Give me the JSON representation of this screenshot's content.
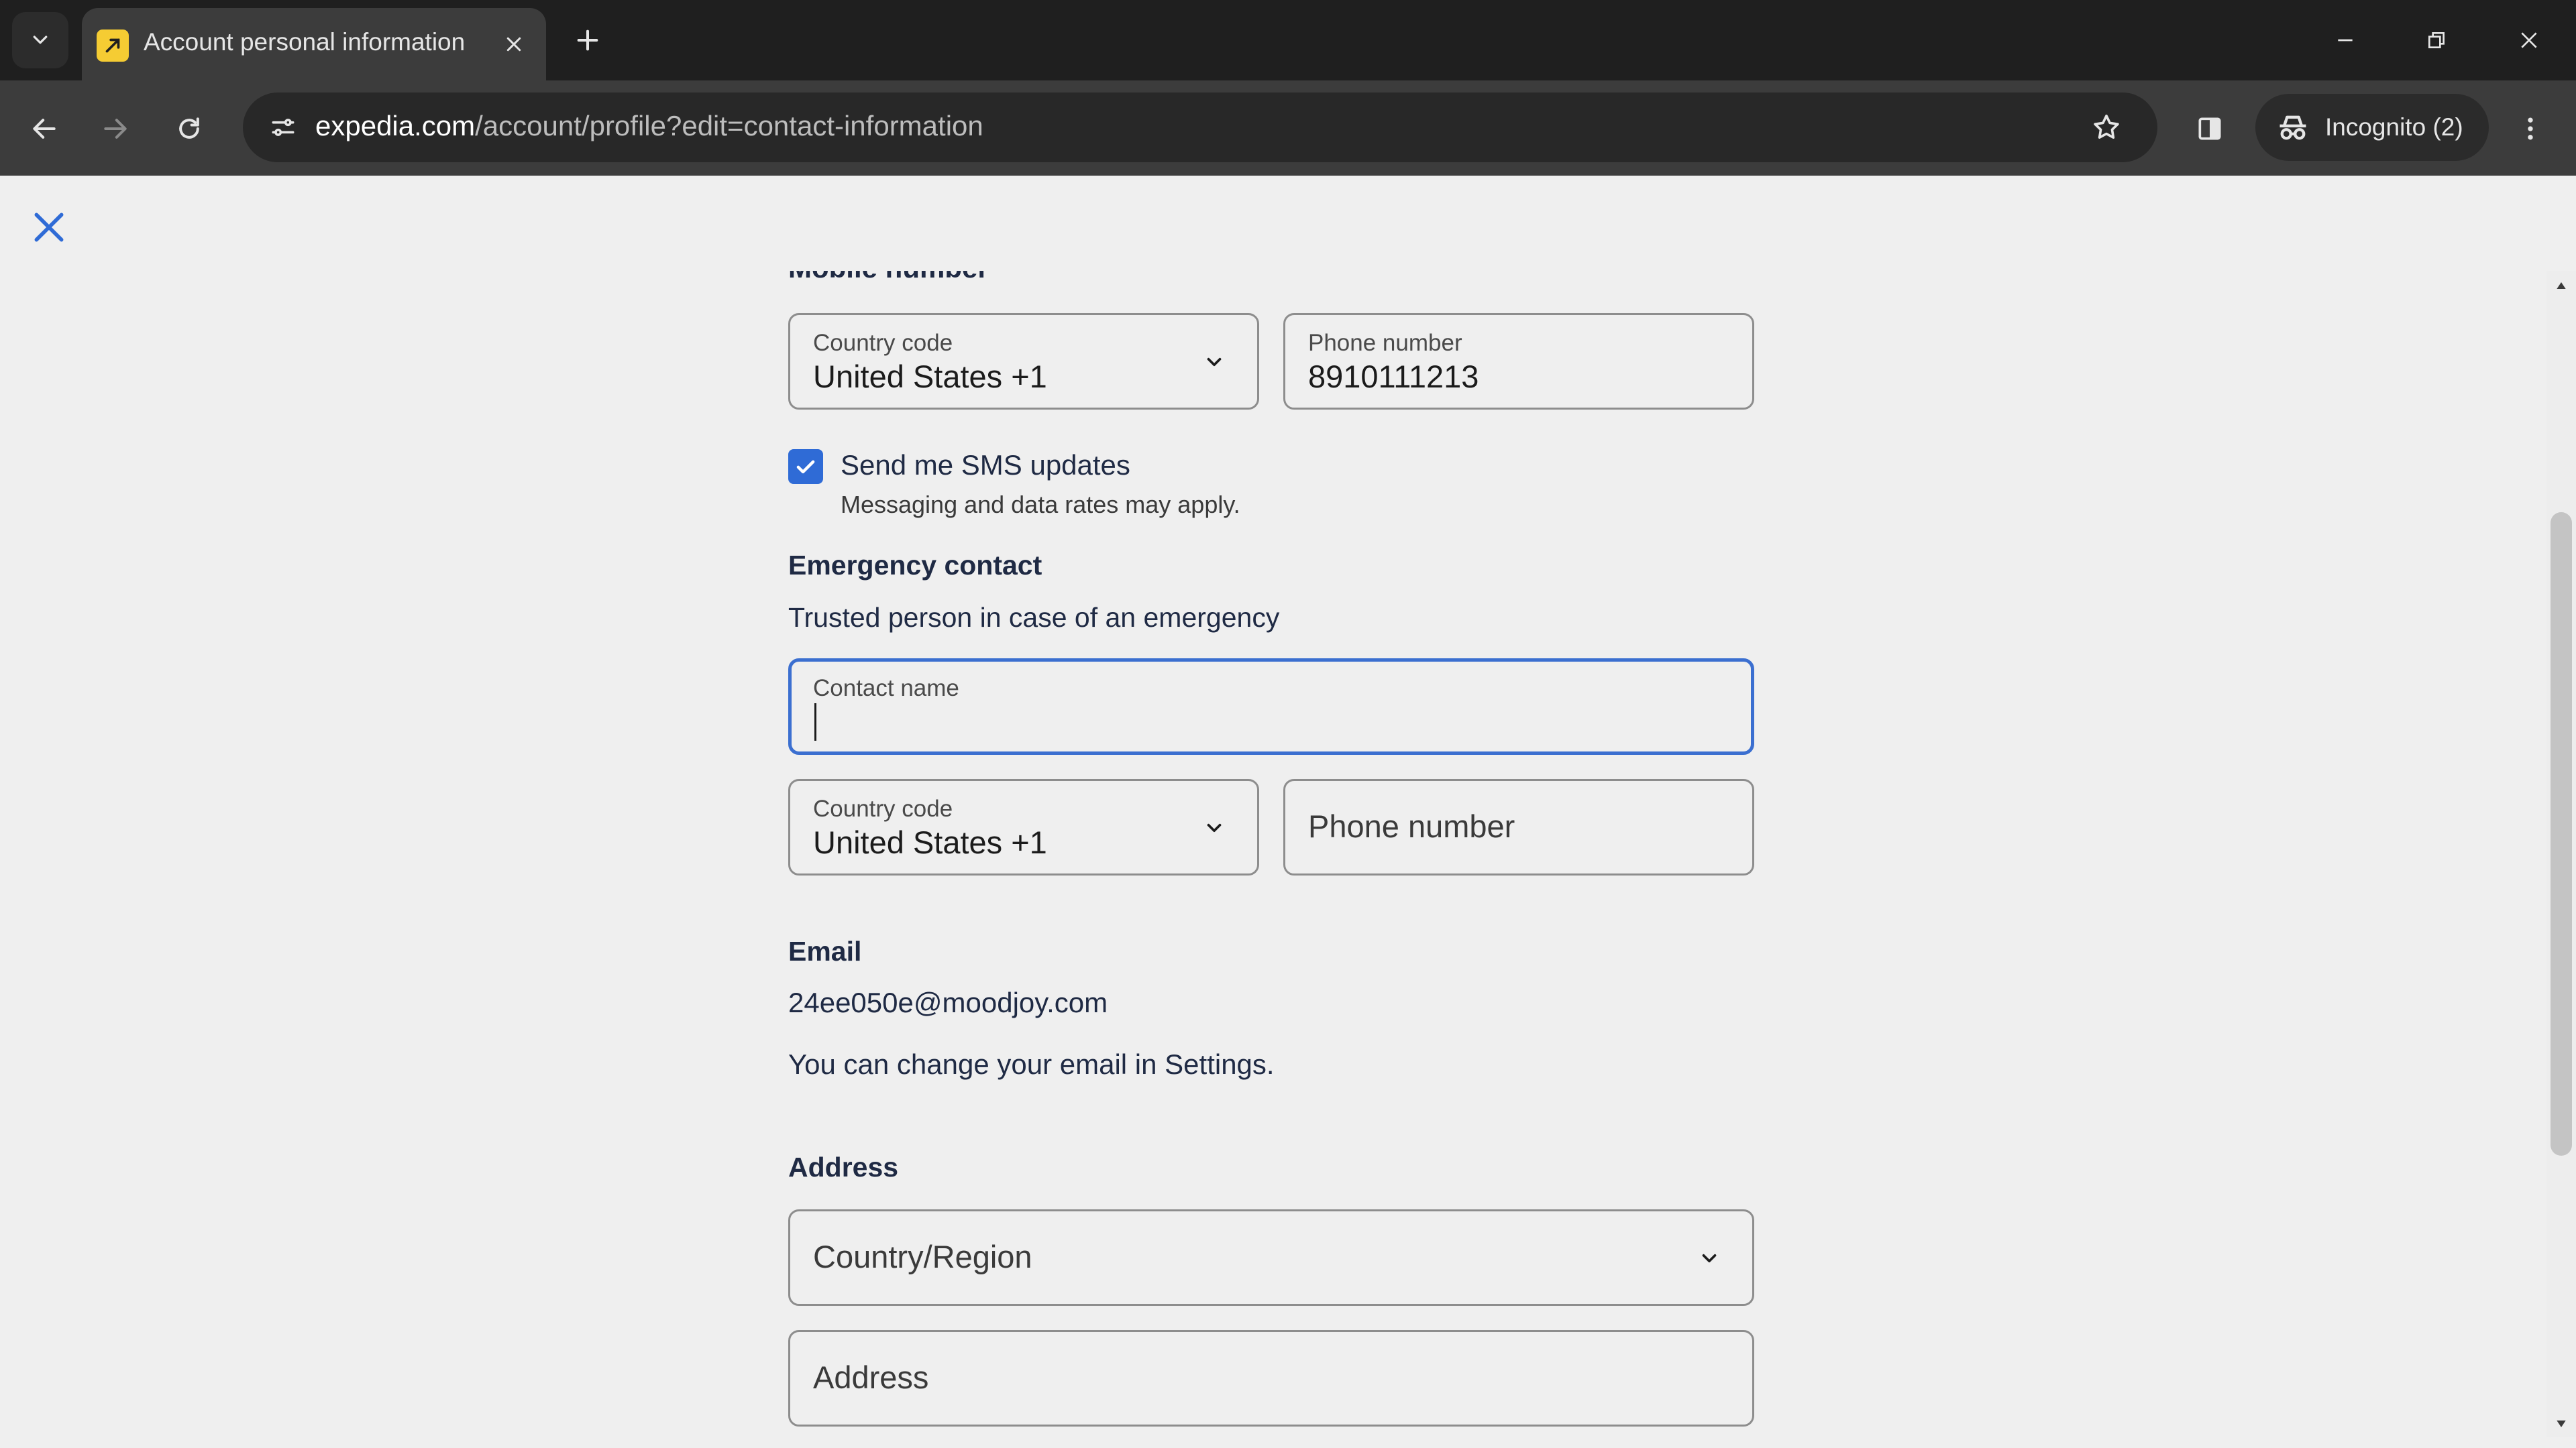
{
  "browser": {
    "tab_title": "Account personal information",
    "url_host": "expedia.com",
    "url_path": "/account/profile?edit=contact-information",
    "incognito_label": "Incognito (2)"
  },
  "page": {
    "mobile_section_label": "Mobile number",
    "mobile": {
      "country_code_label": "Country code",
      "country_code_value": "United States +1",
      "phone_label": "Phone number",
      "phone_value": "8910111213"
    },
    "sms": {
      "checked": true,
      "label": "Send me SMS updates",
      "note": "Messaging and data rates may apply."
    },
    "emergency": {
      "heading": "Emergency contact",
      "description": "Trusted person in case of an emergency",
      "contact_name_label": "Contact name",
      "contact_name_value": "",
      "country_code_label": "Country code",
      "country_code_value": "United States +1",
      "phone_placeholder": "Phone number"
    },
    "email": {
      "heading": "Email",
      "value": "24ee050e@moodjoy.com",
      "note": "You can change your email in Settings."
    },
    "address": {
      "heading": "Address",
      "country_placeholder": "Country/Region",
      "address_placeholder": "Address"
    }
  },
  "colors": {
    "accent": "#2f6bd6",
    "focus_border": "#3b6fd0",
    "text_dark": "#1f2a44",
    "chrome_dark": "#1f1f1f",
    "favicon": "#f5cc33"
  }
}
